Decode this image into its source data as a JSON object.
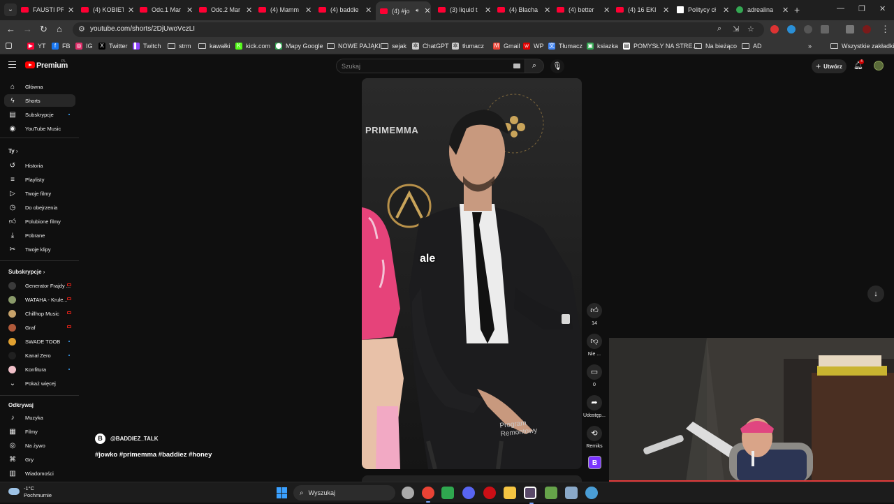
{
  "browser": {
    "tabs": [
      {
        "label": "FAUSTI PR",
        "icon": "youtube-icon"
      },
      {
        "label": "(4) KOBIET",
        "icon": "youtube-icon"
      },
      {
        "label": "Odc.1 Mar",
        "icon": "youtube-icon"
      },
      {
        "label": "Odc.2 Mar",
        "icon": "youtube-icon"
      },
      {
        "label": "(4) Mamm",
        "icon": "youtube-icon"
      },
      {
        "label": "(4) baddie",
        "icon": "youtube-icon"
      },
      {
        "label": "(4) #jo",
        "icon": "youtube-icon",
        "active": true
      },
      {
        "label": "(3) liquid t",
        "icon": "youtube-icon"
      },
      {
        "label": "(4) Blacha",
        "icon": "youtube-icon"
      },
      {
        "label": "(4) better",
        "icon": "youtube-icon"
      },
      {
        "label": "(4) 16 EKI",
        "icon": "youtube-icon"
      },
      {
        "label": "Politycy cł",
        "icon": "news-icon"
      },
      {
        "label": "adrealina",
        "icon": "drive-icon"
      }
    ],
    "url": "youtube.com/shorts/2DjUwoVczLI",
    "bookmarks": [
      {
        "label": "YT",
        "icon": "youtube-icon",
        "color": "#ff0033"
      },
      {
        "label": "FB",
        "icon": "facebook-icon",
        "color": "#1877f2"
      },
      {
        "label": "IG",
        "icon": "instagram-icon",
        "color": "#e1306c"
      },
      {
        "label": "Twitter",
        "icon": "x-icon",
        "color": "#000000"
      },
      {
        "label": "Twitch",
        "icon": "twitch-icon",
        "color": "#9146ff"
      },
      {
        "label": "strm",
        "icon": "folder-icon"
      },
      {
        "label": "kawałki",
        "icon": "folder-icon"
      },
      {
        "label": "kick.com",
        "icon": "kick-icon",
        "color": "#53fc18"
      },
      {
        "label": "Mapy Google",
        "icon": "maps-icon",
        "color": "#34a853"
      },
      {
        "label": "NOWE PAJĄKI",
        "icon": "folder-icon"
      },
      {
        "label": "sejak",
        "icon": "folder-icon"
      },
      {
        "label": "ChatGPT",
        "icon": "chatgpt-icon",
        "color": "#cccccc"
      },
      {
        "label": "tłumacz",
        "icon": "chatgpt-icon",
        "color": "#cccccc"
      },
      {
        "label": "Gmail",
        "icon": "gmail-icon",
        "color": "#ea4335"
      },
      {
        "label": "WP",
        "icon": "wp-icon",
        "color": "#e00000"
      },
      {
        "label": "Tłumacz",
        "icon": "translate-icon",
        "color": "#4285f4"
      },
      {
        "label": "ksiazka",
        "icon": "book-icon",
        "color": "#34a853"
      },
      {
        "label": "POMYSŁY NA STRE...",
        "icon": "doc-icon",
        "color": "#ffffff"
      },
      {
        "label": "Na bieżąco",
        "icon": "folder-icon"
      },
      {
        "label": "AD",
        "icon": "folder-icon"
      }
    ],
    "all_bookmarks": "Wszystkie zakładki"
  },
  "youtube": {
    "logo": "Premium",
    "logo_region": "PL",
    "search_placeholder": "Szukaj",
    "create_label": "Utwórz",
    "notifications_badge": "4",
    "sidebar": {
      "main": [
        {
          "label": "Główna",
          "icon": "home-icon"
        },
        {
          "label": "Shorts",
          "icon": "shorts-icon",
          "active": true
        },
        {
          "label": "Subskrypcje",
          "icon": "subscriptions-icon",
          "dot": true
        },
        {
          "label": "YouTube Music",
          "icon": "music-icon"
        }
      ],
      "you_heading": "Ty",
      "you": [
        {
          "label": "Historia",
          "icon": "history-icon"
        },
        {
          "label": "Playlisty",
          "icon": "playlist-icon"
        },
        {
          "label": "Twoje filmy",
          "icon": "your-videos-icon"
        },
        {
          "label": "Do obejrzenia",
          "icon": "watch-later-icon"
        },
        {
          "label": "Polubione filmy",
          "icon": "like-icon"
        },
        {
          "label": "Pobrane",
          "icon": "download-icon"
        },
        {
          "label": "Twoje klipy",
          "icon": "scissors-icon"
        }
      ],
      "subs_heading": "Subskrypcje",
      "subs": [
        {
          "label": "Generator Frajdy ...",
          "color": "#3a3a3a",
          "live": true
        },
        {
          "label": "WATAHA - Krule...",
          "color": "#8a9a6a",
          "live": true
        },
        {
          "label": "Chillhop Music",
          "color": "#c7a26a",
          "live": true
        },
        {
          "label": "Graf",
          "color": "#b05a3a",
          "live": true
        },
        {
          "label": "SWADE TOOB",
          "color": "#e0a030",
          "dot": true
        },
        {
          "label": "Kanał Zero",
          "color": "#202020",
          "dot": true
        },
        {
          "label": "Konfitura",
          "color": "#f0c0c8",
          "dot": true
        }
      ],
      "more_label": "Pokaż więcej",
      "explore_heading": "Odkrywaj",
      "explore": [
        {
          "label": "Muzyka",
          "icon": "music-note-icon"
        },
        {
          "label": "Filmy",
          "icon": "film-icon"
        },
        {
          "label": "Na żywo",
          "icon": "live-icon"
        },
        {
          "label": "Gry",
          "icon": "gamepad-icon"
        },
        {
          "label": "Wiadomości",
          "icon": "news-icon"
        }
      ]
    },
    "short": {
      "caption": "ale",
      "overlay_brand": "PRIMEMMA",
      "overlay_sign_line1": "Program",
      "overlay_sign_line2": "Remontowy",
      "channel_handle": "@BADDIEZ_TALK",
      "hashtags": "#jowko #primemma #baddiez #honey"
    },
    "actions": [
      {
        "name": "like-button",
        "icon": "thumb-up-icon",
        "count": "14"
      },
      {
        "name": "dislike-button",
        "icon": "thumb-down-icon",
        "count": "Nie ..."
      },
      {
        "name": "comments-button",
        "icon": "comment-icon",
        "count": "0"
      },
      {
        "name": "share-button",
        "icon": "share-icon",
        "count": "Udostęp..."
      },
      {
        "name": "remix-button",
        "icon": "remix-icon",
        "count": "Remiks"
      }
    ]
  },
  "taskbar": {
    "temperature": "-1°C",
    "weather": "Pochmurnie",
    "search_placeholder": "Wyszukaj",
    "apps": [
      {
        "name": "taskview-icon",
        "color": "#aaaaaa"
      },
      {
        "name": "chrome-icon",
        "color": "#ea4335"
      },
      {
        "name": "brave-icon",
        "color": "#2fa84f"
      },
      {
        "name": "discord-icon",
        "color": "#5865f2"
      },
      {
        "name": "opera-icon",
        "color": "#cc0f16"
      },
      {
        "name": "file-explorer-icon",
        "color": "#f5c542"
      },
      {
        "name": "obs-app-icon",
        "color": "#ffffff"
      },
      {
        "name": "minecraft-icon",
        "color": "#66a34a"
      },
      {
        "name": "settings-icon",
        "color": "#8aa9c9"
      },
      {
        "name": "steam-icon",
        "color": "#4a9ed6"
      }
    ]
  }
}
